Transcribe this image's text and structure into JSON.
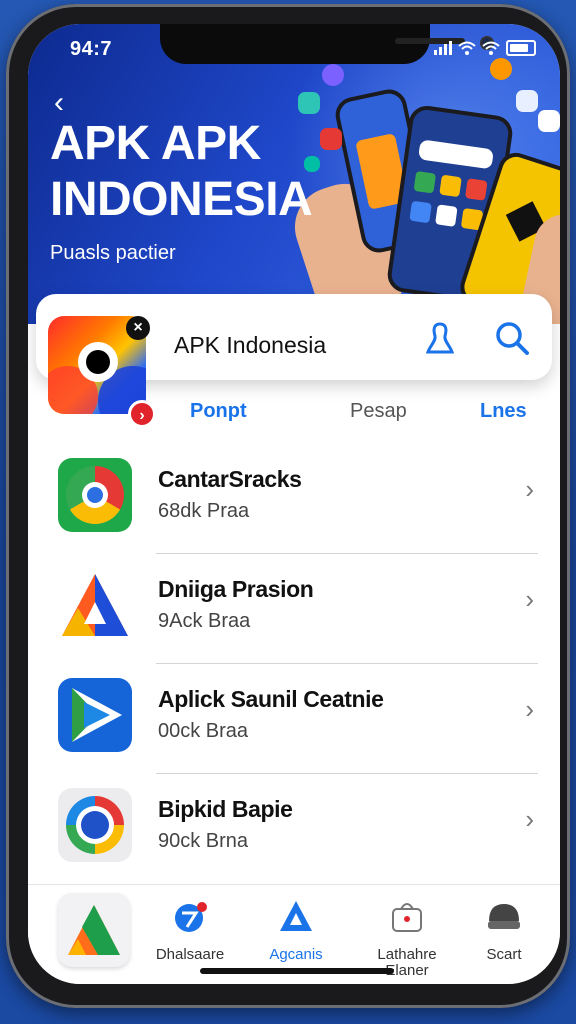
{
  "status_bar": {
    "time": "94:7"
  },
  "header": {
    "title_line1": "APK APK",
    "title_line2": "INDONESIA",
    "subtitle": "Puasls pactier"
  },
  "search_card": {
    "title": "APK Indonesia"
  },
  "tabs": [
    {
      "label": "Ponpt",
      "color": "#1a73e8"
    },
    {
      "label": "Pesap",
      "color": "#555555"
    },
    {
      "label": "Lnes",
      "color": "#1a73e8"
    }
  ],
  "apps": [
    {
      "name": "CantarSracks",
      "sub": "68dk Praa",
      "icon": "chrome-style-icon"
    },
    {
      "name": "Dniiga Prasion",
      "sub": "9Ack Braa",
      "icon": "triangle-icon"
    },
    {
      "name": "Aplick Saunil Ceatnie",
      "sub": "00ck Braa",
      "icon": "play-arrow-icon"
    },
    {
      "name": "Bipkid Bapie",
      "sub": "90ck Brna",
      "icon": "ring-icon"
    }
  ],
  "bottom_nav": [
    {
      "label": "Dhalsaare",
      "icon": "badge-icon"
    },
    {
      "label": "Agcanis",
      "icon": "triangle-icon",
      "active": true
    },
    {
      "label": "Lathahre Elaner",
      "icon": "bag-icon"
    },
    {
      "label": "Scart",
      "icon": "helmet-icon"
    }
  ],
  "colors": {
    "accent": "#1a73e8",
    "hero_start": "#0d2a8f",
    "hero_end": "#3b6ee9",
    "badge_red": "#e1232b"
  }
}
